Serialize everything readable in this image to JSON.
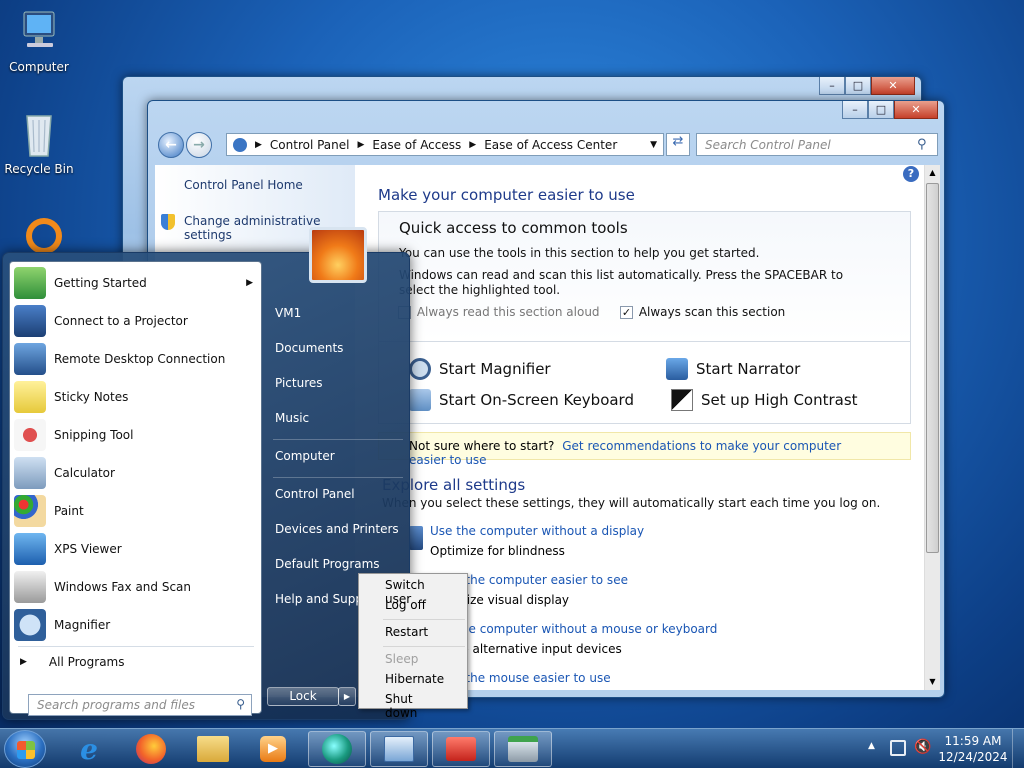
{
  "desktop": {
    "icons": [
      {
        "label": "Computer",
        "icon": "computer-icon"
      },
      {
        "label": "Recycle Bin",
        "icon": "recycle-bin-icon"
      }
    ]
  },
  "explorer": {
    "breadcrumb": [
      "Control Panel",
      "Ease of Access",
      "Ease of Access Center"
    ],
    "search_placeholder": "Search Control Panel",
    "left_pane": {
      "home": "Control Panel Home",
      "admin": "Change administrative settings"
    },
    "main": {
      "title": "Make your computer easier to use",
      "quick_access": {
        "heading": "Quick access to common tools",
        "line1": "You can use the tools in this section to help you get started.",
        "line2": "Windows can read and scan this list automatically.  Press the SPACEBAR to select the highlighted tool.",
        "read_aloud": "Always read this section aloud",
        "scan": "Always scan this section",
        "tools": [
          "Start Magnifier",
          "Start Narrator",
          "Start On-Screen Keyboard",
          "Set up High Contrast"
        ]
      },
      "not_sure": "Not sure where to start?",
      "recommend_link": "Get recommendations to make your computer easier to use",
      "explore": {
        "heading": "Explore all settings",
        "subtitle": "When you select these settings, they will automatically start each time you log on.",
        "items": [
          {
            "link": "Use the computer without a display",
            "desc": "Optimize for blindness"
          },
          {
            "link": "Make the computer easier to see",
            "desc": "Optimize visual display"
          },
          {
            "link": "Use the computer without a mouse or keyboard",
            "desc": "Set up alternative input devices"
          },
          {
            "link": "Make the mouse easier to use",
            "desc": ""
          }
        ]
      }
    }
  },
  "start_menu": {
    "programs": [
      "Getting Started",
      "Connect to a Projector",
      "Remote Desktop Connection",
      "Sticky Notes",
      "Snipping Tool",
      "Calculator",
      "Paint",
      "XPS Viewer",
      "Windows Fax and Scan",
      "Magnifier"
    ],
    "all_programs": "All Programs",
    "search_placeholder": "Search programs and files",
    "right": [
      "VM1",
      "Documents",
      "Pictures",
      "Music",
      "Computer",
      "Control Panel",
      "Devices and Printers",
      "Default Programs",
      "Help and Support"
    ],
    "lock": "Lock"
  },
  "power_menu": [
    "Switch user",
    "Log off",
    "Restart",
    "Sleep",
    "Hibernate",
    "Shut down"
  ],
  "taskbar": {
    "time": "11:59 AM",
    "date": "12/24/2024"
  }
}
